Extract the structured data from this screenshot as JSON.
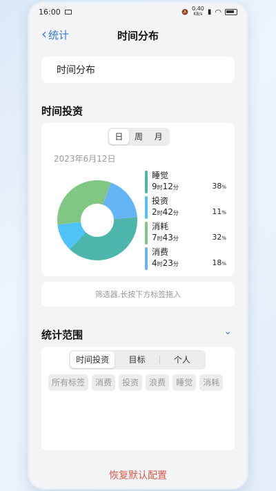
{
  "status_bar": {
    "time": "16:00",
    "net_speed_top": "0.40",
    "net_speed_bottom": "KB/s"
  },
  "nav": {
    "back_label": "统计",
    "title": "时间分布"
  },
  "title_card": {
    "text": "时间分布"
  },
  "time_investment": {
    "section_title": "时间投资",
    "periods": [
      "日",
      "周",
      "月"
    ],
    "active_period": "日",
    "date": "2023年6月12日"
  },
  "chart_data": {
    "type": "pie",
    "categories": [
      "睡觉",
      "投资",
      "消耗",
      "消费"
    ],
    "values": [
      38,
      11,
      32,
      18
    ],
    "units": "%",
    "series": [
      {
        "name": "睡觉",
        "hours": "9",
        "minutes": "12",
        "percent": "38",
        "color": "#4db6ac"
      },
      {
        "name": "投资",
        "hours": "2",
        "minutes": "42",
        "percent": "11",
        "color": "#4fc3f7"
      },
      {
        "name": "消耗",
        "hours": "7",
        "minutes": "43",
        "percent": "32",
        "color": "#81c784"
      },
      {
        "name": "消费",
        "hours": "4",
        "minutes": "23",
        "percent": "18",
        "color": "#64b5f6"
      }
    ],
    "hour_unit": "时",
    "minute_unit": "分",
    "percent_unit": "%"
  },
  "filter": {
    "placeholder": "筛选器,长按下方标签拖入"
  },
  "range": {
    "section_title": "统计范围",
    "toggle_icon": "chevron-down-icon",
    "tabs": [
      "时间投资",
      "目标",
      "个人"
    ],
    "active_tab": "时间投资",
    "tags": [
      "所有标签",
      "消费",
      "投资",
      "浪费",
      "睡觉",
      "消耗"
    ]
  },
  "reset_label": "恢复默认配置",
  "colors": {
    "accent": "#3a7bd5",
    "reset": "#e05a4a"
  }
}
